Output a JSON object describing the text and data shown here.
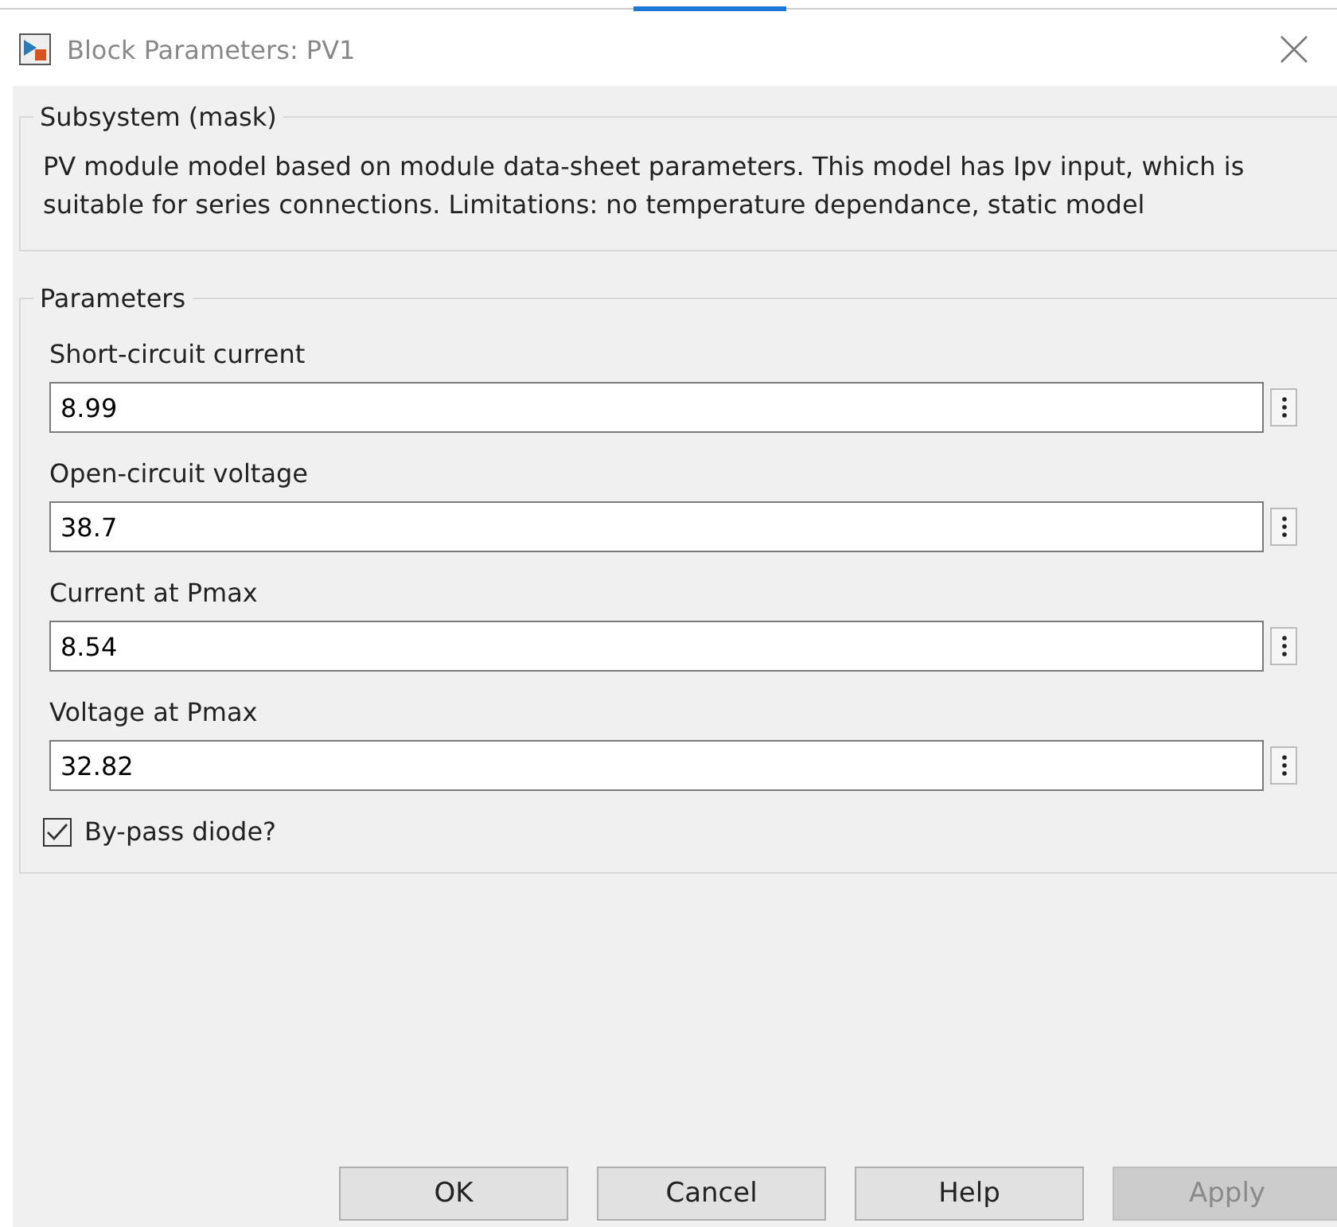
{
  "window": {
    "title": "Block Parameters: PV1"
  },
  "description_group": {
    "title": "Subsystem (mask)",
    "text": "PV module model based on module data-sheet parameters. This model has Ipv input, which is suitable for series connections. Limitations: no temperature dependance, static model"
  },
  "parameters_group": {
    "title": "Parameters",
    "fields": [
      {
        "label": "Short-circuit current",
        "value": "8.99"
      },
      {
        "label": "Open-circuit voltage",
        "value": "38.7"
      },
      {
        "label": "Current at Pmax",
        "value": "8.54"
      },
      {
        "label": "Voltage at Pmax",
        "value": "32.82"
      }
    ],
    "checkbox": {
      "label": "By-pass diode?",
      "checked": true
    }
  },
  "buttons": [
    {
      "label": "OK",
      "disabled": false
    },
    {
      "label": "Cancel",
      "disabled": false
    },
    {
      "label": "Help",
      "disabled": false
    },
    {
      "label": "Apply",
      "disabled": true
    }
  ]
}
